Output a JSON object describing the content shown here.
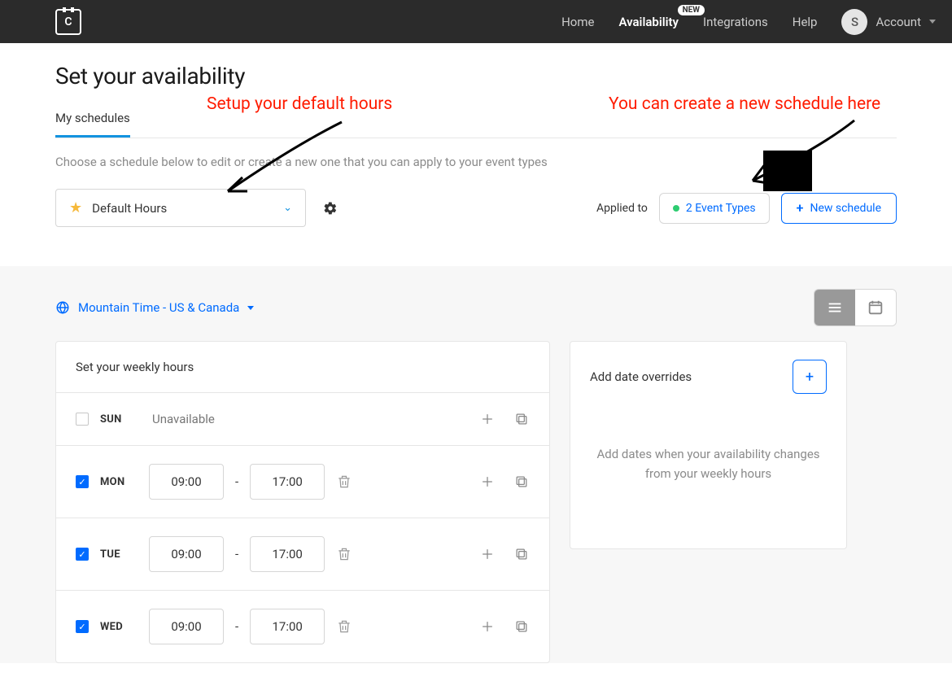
{
  "nav": {
    "logo_letter": "C",
    "items": [
      {
        "label": "Home"
      },
      {
        "label": "Availability",
        "active": true,
        "badge": "NEW"
      },
      {
        "label": "Integrations"
      },
      {
        "label": "Help"
      }
    ],
    "avatar_initial": "S",
    "account_label": "Account"
  },
  "page": {
    "title": "Set your availability",
    "tab": "My schedules",
    "subtext": "Choose a schedule below to edit or create a new one that you can apply to your event types",
    "schedule_selector": "Default Hours",
    "applied_to_label": "Applied to",
    "event_types_label": "2 Event Types",
    "new_schedule_label": "New schedule"
  },
  "workarea": {
    "timezone": "Mountain Time - US & Canada",
    "weekly_title": "Set your weekly hours",
    "overrides_title": "Add date overrides",
    "overrides_empty": "Add dates when your availability changes from your weekly hours",
    "days": [
      {
        "day": "SUN",
        "checked": false,
        "unavailable_text": "Unavailable"
      },
      {
        "day": "MON",
        "checked": true,
        "start": "09:00",
        "end": "17:00"
      },
      {
        "day": "TUE",
        "checked": true,
        "start": "09:00",
        "end": "17:00"
      },
      {
        "day": "WED",
        "checked": true,
        "start": "09:00",
        "end": "17:00"
      }
    ]
  },
  "annotations": {
    "left": "Setup your default hours",
    "right": "You can create a new schedule here"
  }
}
